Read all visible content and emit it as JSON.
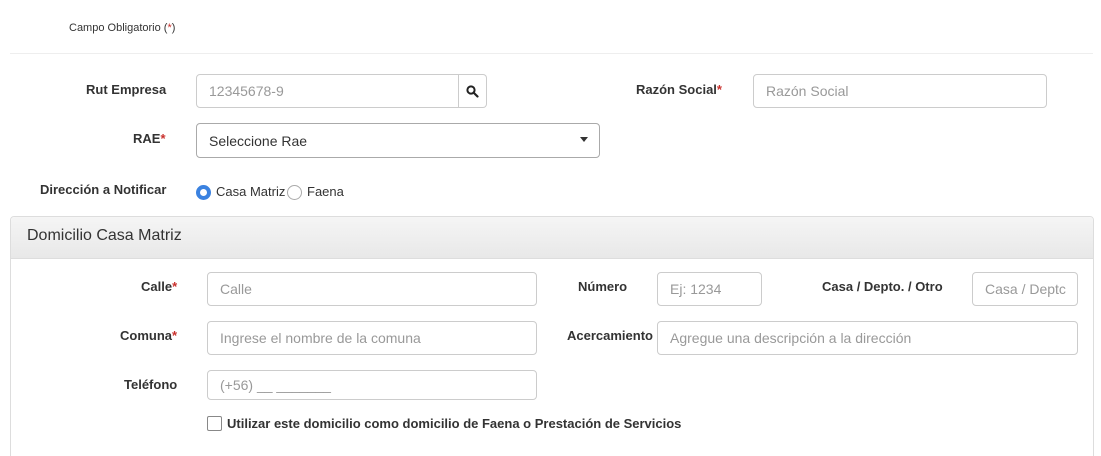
{
  "required_note": {
    "text": "Campo Obligatorio (",
    "star": "*",
    "close": ")"
  },
  "required_marker": "*",
  "company": {
    "rut_label": "Rut Empresa",
    "rut_placeholder": "12345678-9",
    "search_icon": "search-icon",
    "razon_label": "Razón Social",
    "razon_placeholder": "Razón Social",
    "rae_label": "RAE",
    "rae_selected": "Seleccione Rae",
    "address_notify_label": "Dirección a Notificar",
    "radio_options": [
      {
        "label": "Casa Matriz",
        "checked": true
      },
      {
        "label": "Faena",
        "checked": false
      }
    ]
  },
  "domicilio": {
    "title": "Domicilio Casa Matriz",
    "calle_label": "Calle",
    "calle_placeholder": "Calle",
    "numero_label": "Número",
    "numero_placeholder": "Ej: 1234",
    "casa_label": "Casa / Depto. / Otro",
    "casa_placeholder": "Casa / Deptc",
    "comuna_label": "Comuna",
    "comuna_placeholder": "Ingrese el nombre de la comuna",
    "acercamiento_label": "Acercamiento",
    "acercamiento_placeholder": "Agregue una descripción a la dirección",
    "telefono_label": "Teléfono",
    "telefono_placeholder": "(+56) __ _______",
    "checkbox_label": "Utilizar este domicilio como domicilio de Faena o Prestación de Servicios",
    "checkbox_checked": false
  },
  "colors": {
    "required": "#c9302c",
    "radio_accent": "#3b82e0",
    "border": "#cccccc"
  }
}
